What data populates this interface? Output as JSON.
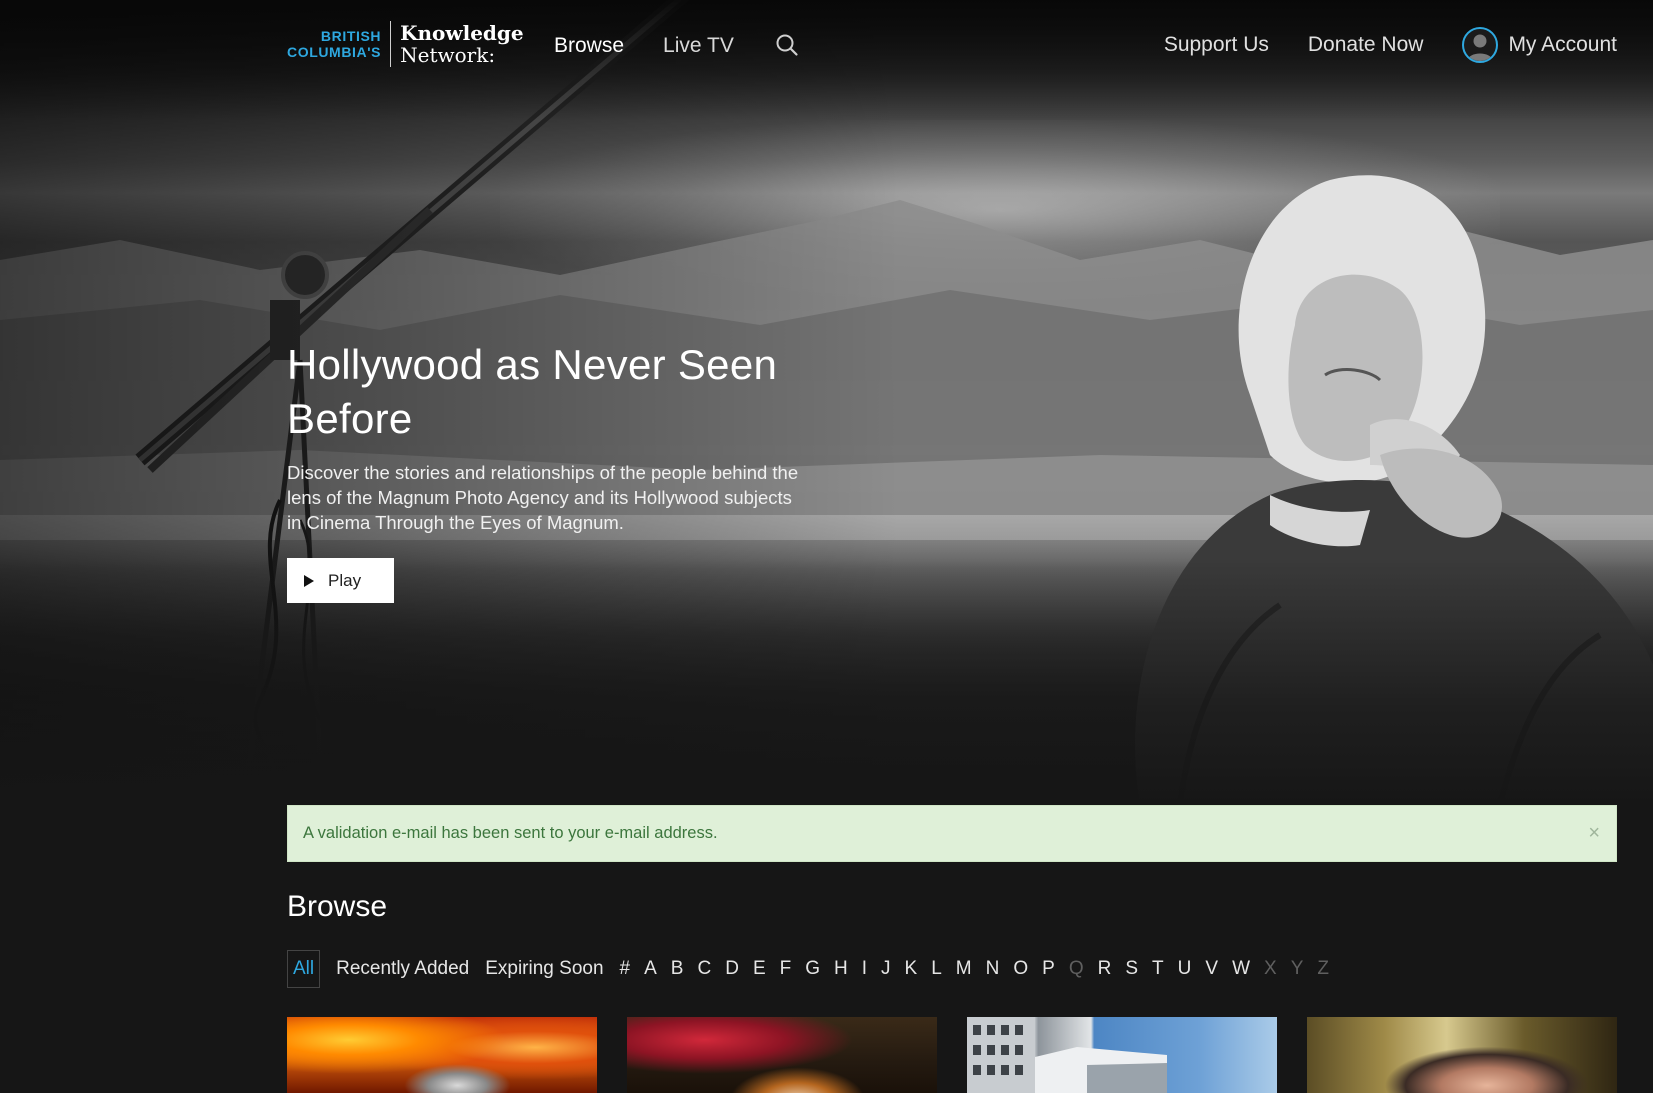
{
  "header": {
    "logo": {
      "line1": "BRITISH",
      "line2": "COLUMBIA'S",
      "brand1": "Knowledge",
      "brand2": "Network:"
    },
    "nav_left": [
      {
        "label": "Browse"
      },
      {
        "label": "Live TV"
      }
    ],
    "search_icon": "search-icon",
    "nav_right": [
      {
        "label": "Support Us"
      },
      {
        "label": "Donate Now"
      }
    ],
    "account_label": "My Account",
    "accent_color": "#2ea8e0"
  },
  "hero": {
    "title": "Hollywood as Never Seen Before",
    "description": "Discover the stories and relationships of the people behind the lens of the Magnum Photo Agency and its Hollywood subjects in Cinema Through the Eyes of Magnum.",
    "play_label": "Play"
  },
  "alert": {
    "message": "A validation e-mail has been sent to your e-mail address.",
    "close_glyph": "×",
    "background": "#dff0d8",
    "text_color": "#3c763d"
  },
  "browse": {
    "title": "Browse",
    "filters": [
      {
        "label": "All",
        "active": true
      },
      {
        "label": "Recently Added"
      },
      {
        "label": "Expiring Soon"
      }
    ],
    "letters": [
      "#",
      "A",
      "B",
      "C",
      "D",
      "E",
      "F",
      "G",
      "H",
      "I",
      "J",
      "K",
      "L",
      "M",
      "N",
      "O",
      "P",
      "Q",
      "R",
      "S",
      "T",
      "U",
      "V",
      "W",
      "X",
      "Y",
      "Z"
    ],
    "disabled_letters": [
      "Q",
      "X",
      "Y",
      "Z"
    ]
  }
}
